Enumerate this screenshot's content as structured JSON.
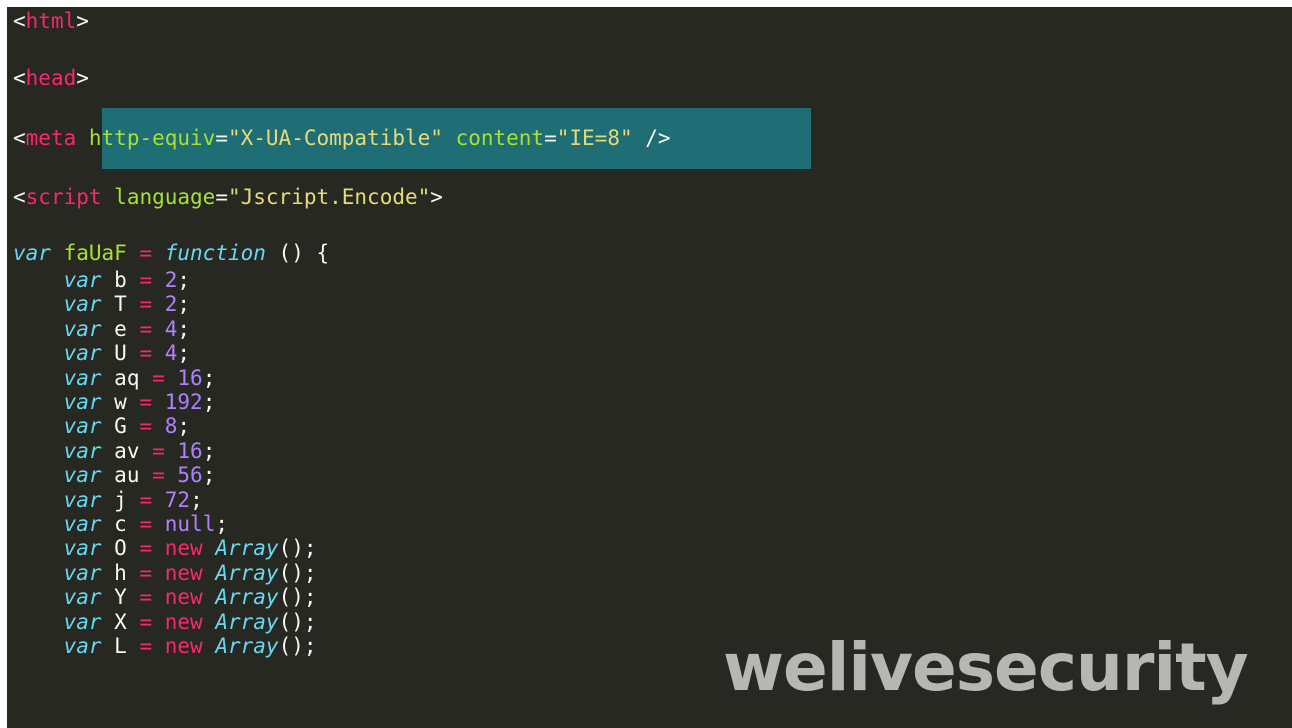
{
  "markup": {
    "html_tag": "html",
    "head_tag": "head",
    "meta_tag": "meta",
    "meta_attr1_name": "http-equiv",
    "meta_attr1_value": "\"X-UA-Compatible\"",
    "meta_attr2_name": "content",
    "meta_attr2_value": "\"IE=8\"",
    "meta_close": "/>",
    "script_tag": "script",
    "script_attr_name": "language",
    "script_attr_value": "\"Jscript.Encode\""
  },
  "code": {
    "fn_keyword": "var",
    "fn_name": "faUaF",
    "fn_function": "function",
    "fn_rest": " () {",
    "decls": [
      {
        "name": "b",
        "value": "2"
      },
      {
        "name": "T",
        "value": "2"
      },
      {
        "name": "e",
        "value": "4"
      },
      {
        "name": "U",
        "value": "4"
      },
      {
        "name": "aq",
        "value": "16"
      },
      {
        "name": "w",
        "value": "192"
      },
      {
        "name": "G",
        "value": "8"
      },
      {
        "name": "av",
        "value": "16"
      },
      {
        "name": "au",
        "value": "56"
      },
      {
        "name": "j",
        "value": "72"
      },
      {
        "name": "c",
        "value": "null"
      }
    ],
    "arrays": [
      "O",
      "h",
      "Y",
      "X",
      "L"
    ],
    "var_kw": "var",
    "new_kw": "new",
    "array_ctor": "Array",
    "array_tail": "();"
  },
  "watermark": "welivesecurity",
  "colors": {
    "background": "#272822",
    "selection": "#1f6e75",
    "tag": "#f92672",
    "attribute": "#a6e22e",
    "string": "#e6db74",
    "keyword": "#66d9ef",
    "number": "#ae81ff"
  }
}
